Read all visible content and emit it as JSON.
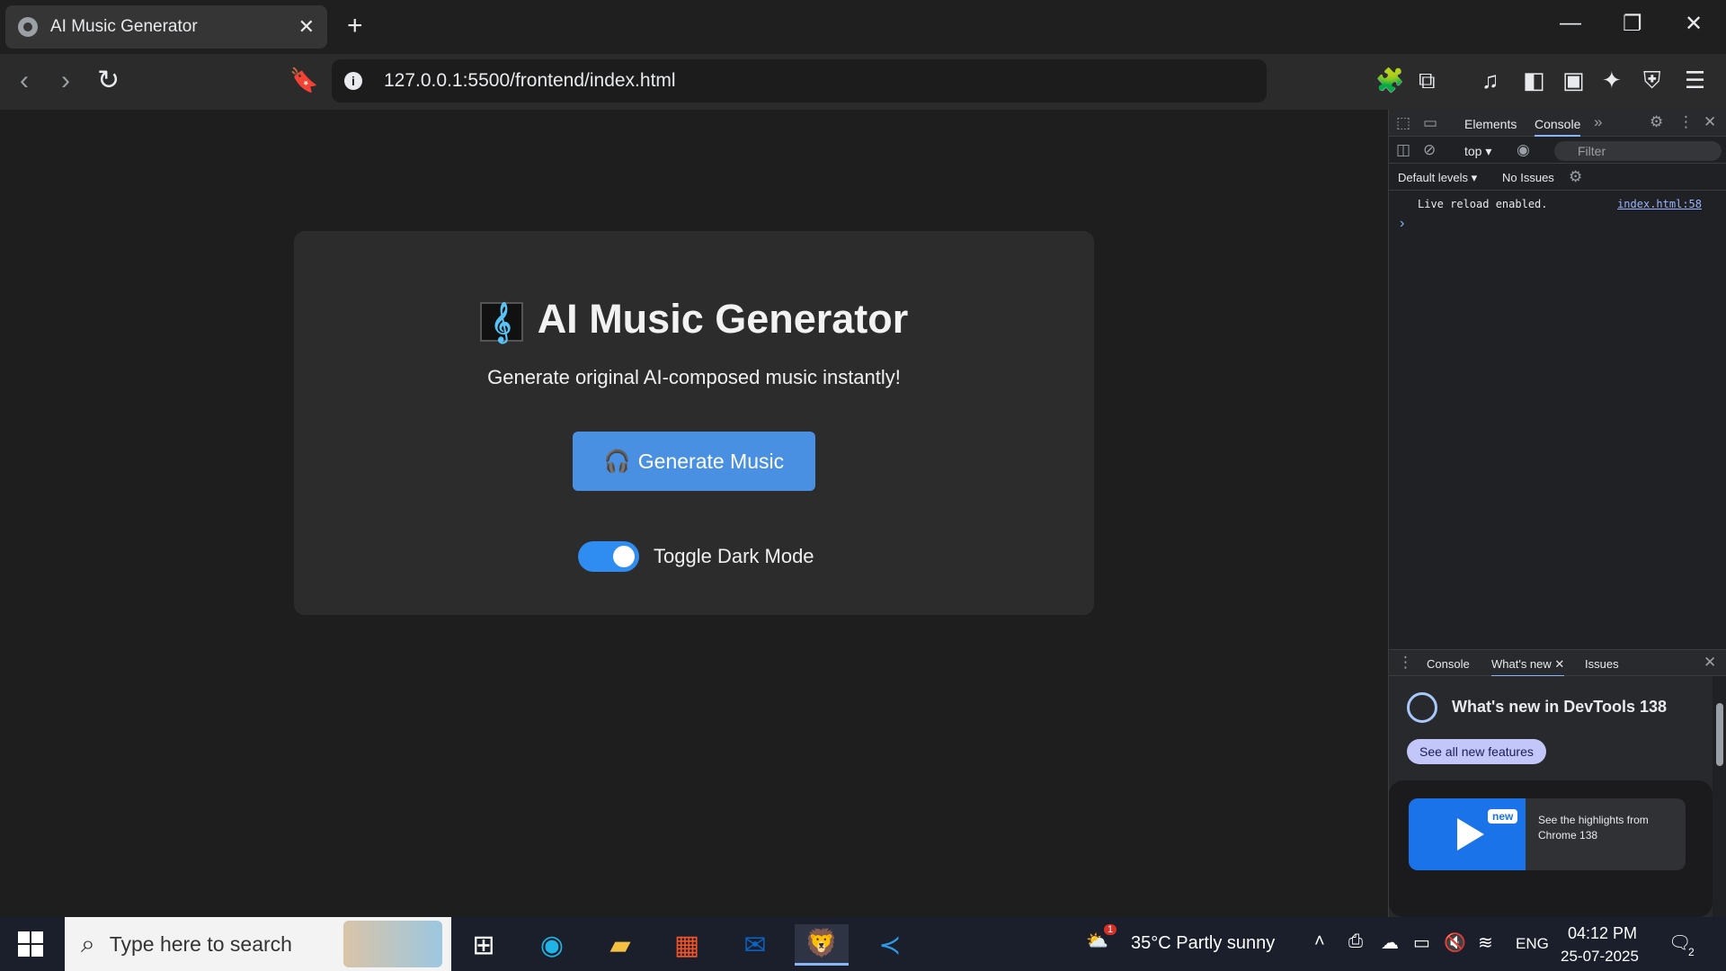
{
  "browser": {
    "tab_title": "AI Music Generator",
    "url": "127.0.0.1:5500/frontend/index.html"
  },
  "app": {
    "title": "AI Music Generator",
    "subtitle": "Generate original AI-composed music instantly!",
    "generate_label": "Generate Music",
    "toggle_label": "Toggle Dark Mode",
    "dark_mode_on": true,
    "accent_color": "#4a90e2"
  },
  "devtools": {
    "tabs": [
      "Elements",
      "Console"
    ],
    "active_tab": "Console",
    "context": "top",
    "filter_placeholder": "Filter",
    "levels": "Default levels",
    "issues": "No Issues",
    "console_message": "Live reload enabled.",
    "console_source": "index.html:58",
    "drawer_tabs": [
      "Console",
      "What's new",
      "Issues"
    ],
    "whats_new_title": "What's new in DevTools 138",
    "whats_new_button": "See all new features",
    "whats_new_badge": "new",
    "whats_new_card_text": "See the highlights from Chrome 138"
  },
  "taskbar": {
    "search_placeholder": "Type here to search",
    "weather": "35°C  Partly sunny",
    "weather_badge": "1",
    "language": "ENG",
    "time": "04:12 PM",
    "date": "25-07-2025",
    "notifications": "2"
  }
}
